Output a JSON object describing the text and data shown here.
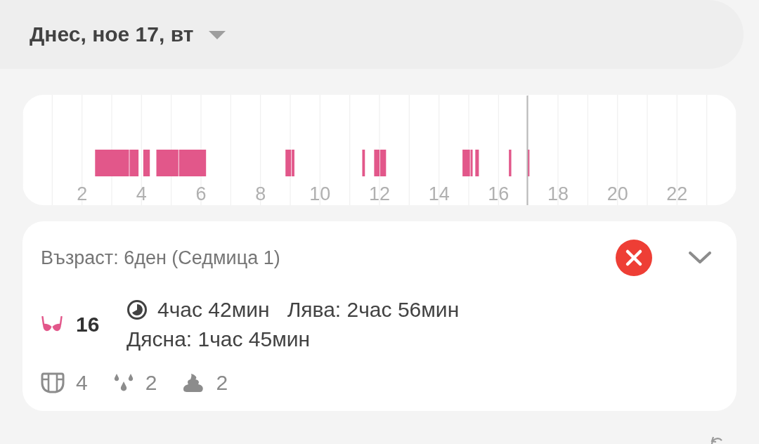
{
  "header": {
    "date": "Днес, ное 17, вт"
  },
  "timeline": {
    "hour_labels": [
      "2",
      "4",
      "6",
      "8",
      "10",
      "12",
      "14",
      "16",
      "18",
      "20",
      "22"
    ]
  },
  "summary": {
    "age": "Възраст: 6ден (Седмица 1)",
    "expanded": false,
    "feedings": {
      "count": "16",
      "total": "4час 42мин",
      "left": "Лява: 2час 56мин",
      "right": "Дясна: 1час 45мин"
    },
    "diapers": [
      {
        "kind": "diaper",
        "count": "4"
      },
      {
        "kind": "wet",
        "count": "2"
      },
      {
        "kind": "dirty",
        "count": "2"
      }
    ]
  }
}
